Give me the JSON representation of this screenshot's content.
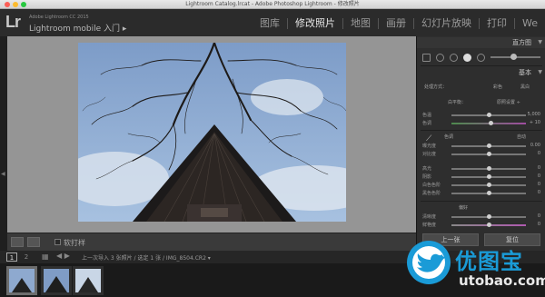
{
  "window": {
    "title": "Lightroom Catalog.lrcat - Adobe Photoshop Lightroom - 修改照片"
  },
  "identity": {
    "logo": "Lr",
    "version": "Adobe Lightroom CC 2015",
    "mobile": "Lightroom mobile 入门 ▸"
  },
  "modules": [
    {
      "label": "图库",
      "active": false
    },
    {
      "label": "修改照片",
      "active": true
    },
    {
      "label": "地图",
      "active": false
    },
    {
      "label": "画册",
      "active": false
    },
    {
      "label": "幻灯片放映",
      "active": false
    },
    {
      "label": "打印",
      "active": false
    },
    {
      "label": "We",
      "active": false
    }
  ],
  "right_panel": {
    "histogram_label": "直方图",
    "basic_label": "基本",
    "treatment_label": "处理方式：",
    "color_label": "彩色",
    "bw_label": "黑白",
    "wb_label": "白平衡：",
    "wb_value": "原照设置 ÷",
    "temp": {
      "label": "色温",
      "value": "5,000",
      "position": 0.5
    },
    "tint": {
      "label": "色调",
      "value": "+ 10",
      "position": 0.52
    },
    "tone_label": "色调",
    "auto_label": "自动",
    "exposure": {
      "label": "曝光度",
      "value": "0.00",
      "position": 0.5
    },
    "contrast": {
      "label": "对比度",
      "value": "0",
      "position": 0.5
    },
    "highlights": {
      "label": "高光",
      "value": "0",
      "position": 0.5
    },
    "shadows": {
      "label": "阴影",
      "value": "0",
      "position": 0.5
    },
    "whites": {
      "label": "白色色阶",
      "value": "0",
      "position": 0.5
    },
    "blacks": {
      "label": "黑色色阶",
      "value": "0",
      "position": 0.5
    },
    "presence_label": "偏好",
    "clarity": {
      "label": "清晰度",
      "value": "0",
      "position": 0.5
    },
    "vibrance": {
      "label": "鲜艳度",
      "value": "0",
      "position": 0.5
    },
    "prev_button": "上一张",
    "reset_button": "复位"
  },
  "toolbar": {
    "softproof_label": "软打样"
  },
  "filmstrip": {
    "page1": "1",
    "page2": "2",
    "breadcrumb": "上一次导入   3 张照片 / 选定 1 张 / IMG_8504.CR2 ▾"
  },
  "watermark": {
    "text": "优图宝",
    "sub": "utobao.com"
  },
  "colors": {
    "accent": "#1a9bd7",
    "panel": "#2e2e2e",
    "canvas": "#959595"
  }
}
